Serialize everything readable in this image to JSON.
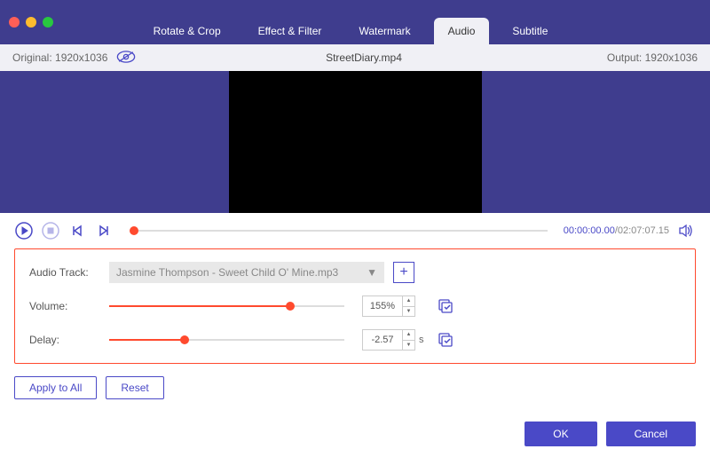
{
  "tabs": {
    "rotate": "Rotate & Crop",
    "effect": "Effect & Filter",
    "watermark": "Watermark",
    "audio": "Audio",
    "subtitle": "Subtitle"
  },
  "info": {
    "original": "Original: 1920x1036",
    "filename": "StreetDiary.mp4",
    "output": "Output: 1920x1036"
  },
  "playback": {
    "current": "00:00:00.00",
    "total": "/02:07:07.15"
  },
  "settings": {
    "audio_track_label": "Audio Track:",
    "audio_track_value": "Jasmine Thompson - Sweet Child O' Mine.mp3",
    "volume_label": "Volume:",
    "volume_value": "155%",
    "volume_percent": 77,
    "delay_label": "Delay:",
    "delay_value": "-2.57",
    "delay_unit": "s",
    "delay_percent": 32
  },
  "buttons": {
    "apply_all": "Apply to All",
    "reset": "Reset",
    "ok": "OK",
    "cancel": "Cancel",
    "add": "+"
  }
}
